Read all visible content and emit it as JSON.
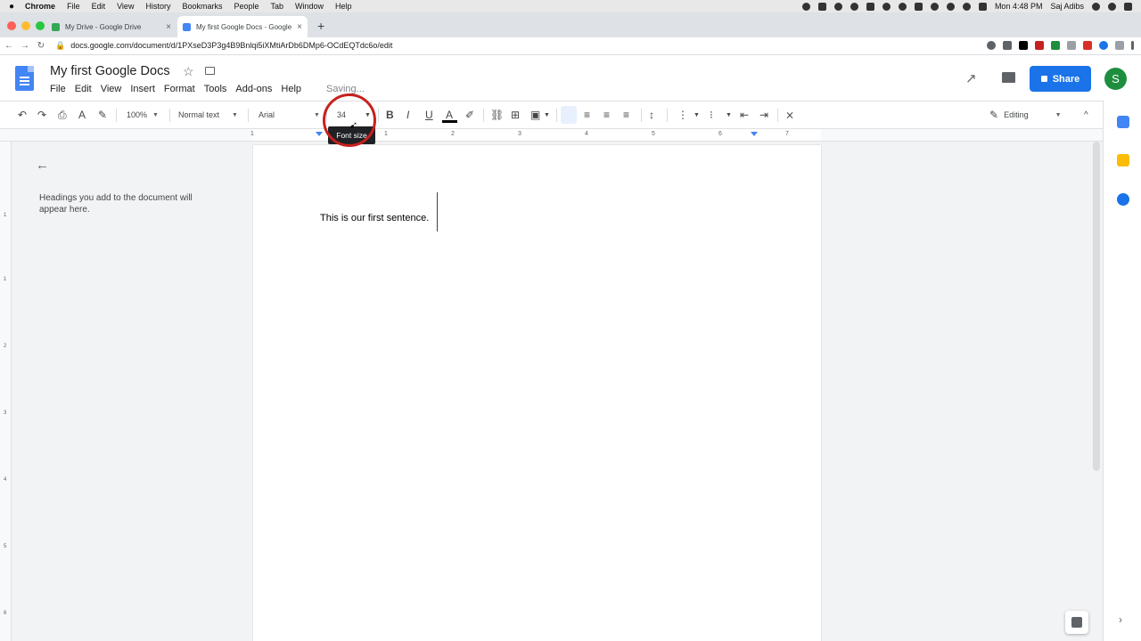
{
  "os_menubar": {
    "apple": "",
    "items": [
      "Chrome",
      "File",
      "Edit",
      "View",
      "History",
      "Bookmarks",
      "People",
      "Tab",
      "Window",
      "Help"
    ],
    "clock": "Mon 4:48 PM",
    "user": "Saj Adibs"
  },
  "browser": {
    "tabs": [
      {
        "title": "My Drive - Google Drive",
        "close": "×"
      },
      {
        "title": "My first Google Docs - Google",
        "close": "×"
      }
    ],
    "new_tab": "+",
    "url": "docs.google.com/document/d/1PXseD3P3g4B9Bnlqi5iXMtiArDb6DMp6-OCdEQTdc6o/edit",
    "back": "←",
    "forward": "→",
    "reload": "↻",
    "lock": "🔒"
  },
  "doc": {
    "title": "My first Google Docs",
    "menus": [
      "File",
      "Edit",
      "View",
      "Insert",
      "Format",
      "Tools",
      "Add-ons",
      "Help"
    ],
    "status": "Saving...",
    "share_label": "Share",
    "avatar_letter": "S"
  },
  "toolbar": {
    "undo": "↶",
    "redo": "↷",
    "print": "⎙",
    "spell": "A",
    "paint": "✎",
    "zoom": "100%",
    "style": "Normal text",
    "font": "Arial",
    "font_size": "34",
    "minus": "−",
    "bold": "B",
    "italic": "I",
    "underline": "U",
    "text_color": "A",
    "highlight": "✐",
    "link": "⛓",
    "comment": "⊞",
    "image": "▣",
    "align_left": "≡",
    "align_center": "≡",
    "align_right": "≡",
    "justify": "≡",
    "line_spacing": "↕",
    "numbered": "⋮",
    "bulleted": "⁝",
    "indent_less": "⇤",
    "indent_more": "⇥",
    "clear_format": "⨯",
    "mode": "Editing",
    "collapse": "^",
    "tooltip": "Font size"
  },
  "ruler": {
    "numbers": [
      "1",
      "1",
      "2",
      "3",
      "4",
      "5",
      "6",
      "7"
    ],
    "vnumbers": [
      "1",
      "1",
      "2",
      "3",
      "4",
      "5",
      "6"
    ]
  },
  "outline": {
    "back": "←",
    "placeholder": "Headings you add to the document will appear here."
  },
  "content": {
    "sentence": "This is our first sentence."
  },
  "sidepanel": {
    "chevron": "›"
  },
  "colors": {
    "accent": "#1a73e8",
    "avatar": "#1e8e3e",
    "highlight_ring": "#c5221f"
  }
}
